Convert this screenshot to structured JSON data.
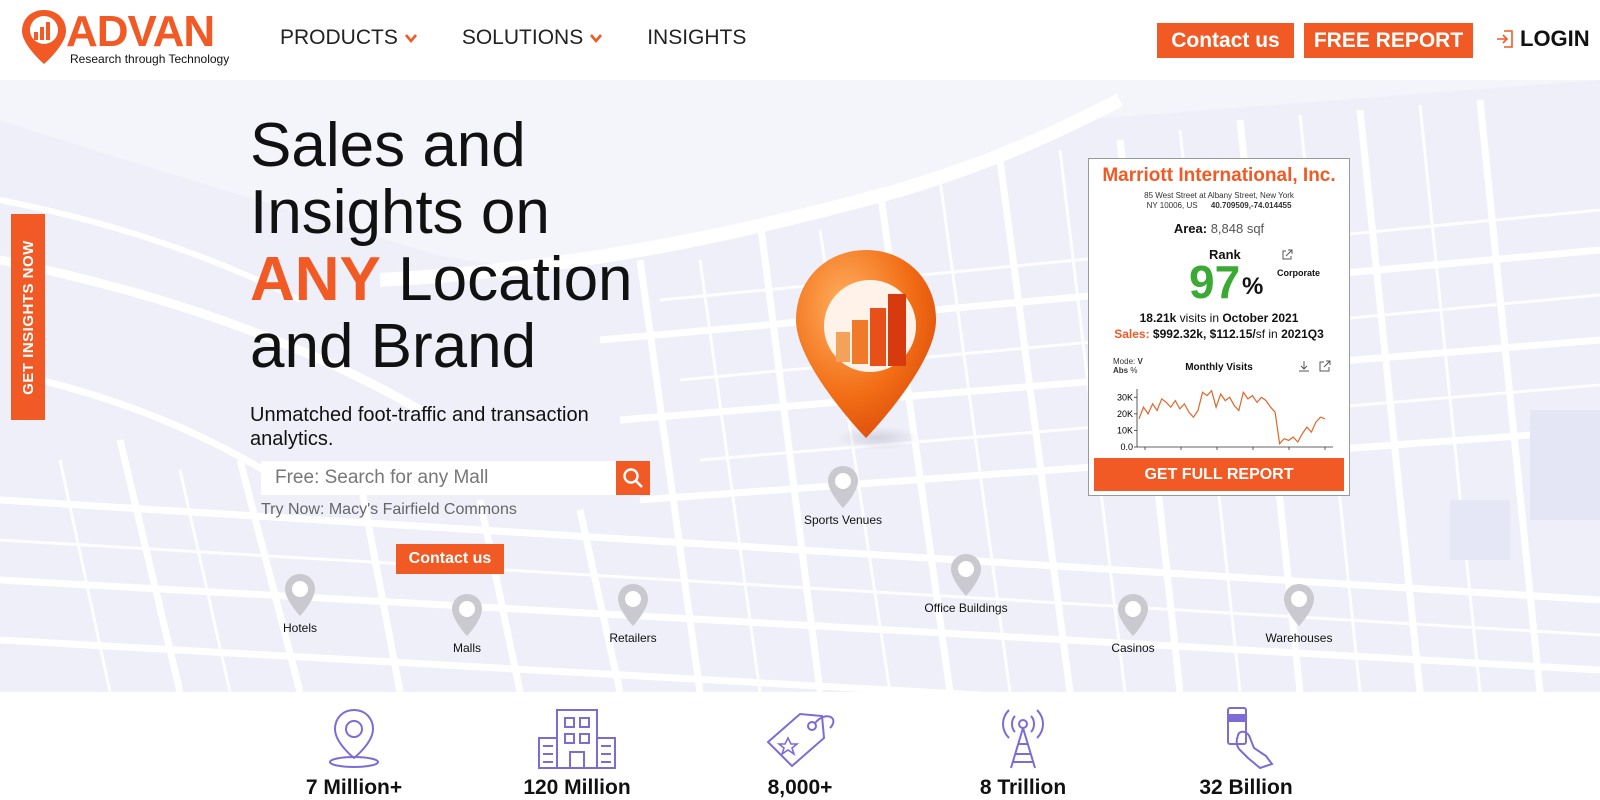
{
  "header": {
    "logo_text": "ADVAN",
    "logo_tagline": "Research through Technology",
    "nav": [
      {
        "label": "PRODUCTS"
      },
      {
        "label": "SOLUTIONS"
      },
      {
        "label": "INSIGHTS"
      }
    ],
    "contact_label": "Contact us",
    "report_label": "FREE REPORT",
    "login_label": "LOGIN"
  },
  "hero": {
    "headline_line1": "Sales and",
    "headline_line2": "Insights on",
    "headline_accent": "ANY",
    "headline_line3_rest": " Location",
    "headline_line4": "and Brand",
    "subline": "Unmatched foot-traffic and transaction analytics.",
    "search_placeholder": "Free: Search for any Mall",
    "try_now": "Try Now: Macy's Fairfield Commons",
    "contact_label": "Contact us",
    "side_tab_label": "GET INSIGHTS NOW"
  },
  "pins": [
    {
      "label": "Sports Venues"
    },
    {
      "label": "Hotels"
    },
    {
      "label": "Malls"
    },
    {
      "label": "Retailers"
    },
    {
      "label": "Office Buildings"
    },
    {
      "label": "Casinos"
    },
    {
      "label": "Warehouses"
    }
  ],
  "card": {
    "title": "Marriott International, Inc.",
    "address_line1": "85 West Street at Albany Street, New York",
    "address_line2": "NY 10006, US",
    "coords": "40.709509,-74.014455",
    "area_label": "Area:",
    "area_value": "8,848 sqf",
    "rank_label": "Rank",
    "rank_value": "97",
    "rank_unit": "%",
    "corporate_label": "Corporate",
    "visits_value": "18.21k",
    "visits_mid": " visits in ",
    "visits_period": "October 2021",
    "sales_label": "Sales:",
    "sales_value": " $992.32k, $112.15/",
    "sales_unit": "sf",
    "sales_in": " in ",
    "sales_period": "2021Q3",
    "mode_label": "Mode:",
    "mode_value": "V",
    "abs_label": "Abs",
    "abs_value": "%",
    "chart_title": "Monthly Visits",
    "button_label": "GET FULL REPORT"
  },
  "chart_data": {
    "type": "line",
    "title": "Monthly Visits",
    "xlabel": "",
    "ylabel": "",
    "ylim": [
      0,
      35000
    ],
    "ytick_labels": [
      "30K",
      "20K",
      "10K",
      "0.0"
    ],
    "yticks": [
      30000,
      20000,
      10000,
      0
    ],
    "series": [
      {
        "values": [
          17000,
          24000,
          20000,
          26000,
          22000,
          29000,
          27000,
          24000,
          28000,
          23000,
          26000,
          21000,
          18000,
          22000,
          33000,
          31000,
          34000,
          24000,
          32000,
          28000,
          30000,
          25000,
          22000,
          33000,
          29000,
          31000,
          27000,
          30000,
          28000,
          24000,
          21000,
          2000,
          5000,
          4000,
          6000,
          3000,
          8000,
          12000,
          9000,
          15000,
          18000,
          17000
        ]
      }
    ],
    "color": "#e0662a"
  },
  "stats": [
    {
      "value": "7 Million+",
      "icon": "location-pin-icon"
    },
    {
      "value": "120 Million",
      "icon": "building-icon"
    },
    {
      "value": "8,000+",
      "icon": "price-tag-icon"
    },
    {
      "value": "8 Trillion",
      "icon": "radio-tower-icon"
    },
    {
      "value": "32 Billion",
      "icon": "card-payment-icon"
    }
  ],
  "colors": {
    "accent": "#f15a24",
    "rank_green": "#3aaa35",
    "icon_purple": "#7f6bd6",
    "map_bg": "#eeeff8"
  }
}
